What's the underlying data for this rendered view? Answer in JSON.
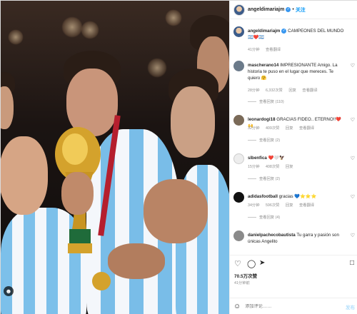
{
  "post": {
    "username": "angeldimariajm",
    "follow_label": "关注",
    "caption_text": "CAMPEONES DEL MUNDO",
    "caption_emoji": "🇦🇷❤️🇦🇷",
    "caption_time": "41分钟",
    "caption_translate": "查看翻译"
  },
  "comments": [
    {
      "username": "mascherano14",
      "text": "IMPRESIONANTE Amigo. La historia te puso en el lugar que mereces. Te quiero 🤗",
      "time": "28分钟",
      "likes": "6,332次赞",
      "reply": "回复",
      "translate": "查看翻译",
      "replies": "查看回复 (110)",
      "avatar_color": "#6b7a8a"
    },
    {
      "username": "leonardogi18",
      "text": "GRACIAS FIDEO.. ETERNO!!❤️🙌",
      "time": "32分钟",
      "likes": "409次赞",
      "reply": "回复",
      "translate": "查看翻译",
      "replies": "查看回复 (2)",
      "avatar_color": "#7a6a58"
    },
    {
      "username": "slbenfica",
      "text": "❤️🤍🦅",
      "time": "15分钟",
      "likes": "408次赞",
      "reply": "回复",
      "replies": "查看回复 (2)",
      "avatar_color": "#d8d8d8"
    },
    {
      "username": "adidasfootball",
      "text": "gracias 💙⭐⭐⭐",
      "time": "34分钟",
      "likes": "596次赞",
      "reply": "回复",
      "translate": "查看翻译",
      "replies": "查看回复 (4)",
      "avatar_color": "#111111"
    },
    {
      "username": "danielpachecobautista",
      "text": "Tu garra y pasión son únicas Angelito",
      "avatar_color": "#8a8a8a"
    }
  ],
  "actions": {
    "like_icon": "heart-icon",
    "comment_icon": "comment-icon",
    "share_icon": "share-icon",
    "save_icon": "bookmark-icon",
    "likes": "70.5万次赞",
    "date": "41分钟前"
  },
  "add_comment": {
    "placeholder": "添加评论……",
    "post_label": "发布"
  },
  "colors": {
    "link": "#0095f6",
    "verified": "#3897f0",
    "meta": "#8e8e8e"
  }
}
